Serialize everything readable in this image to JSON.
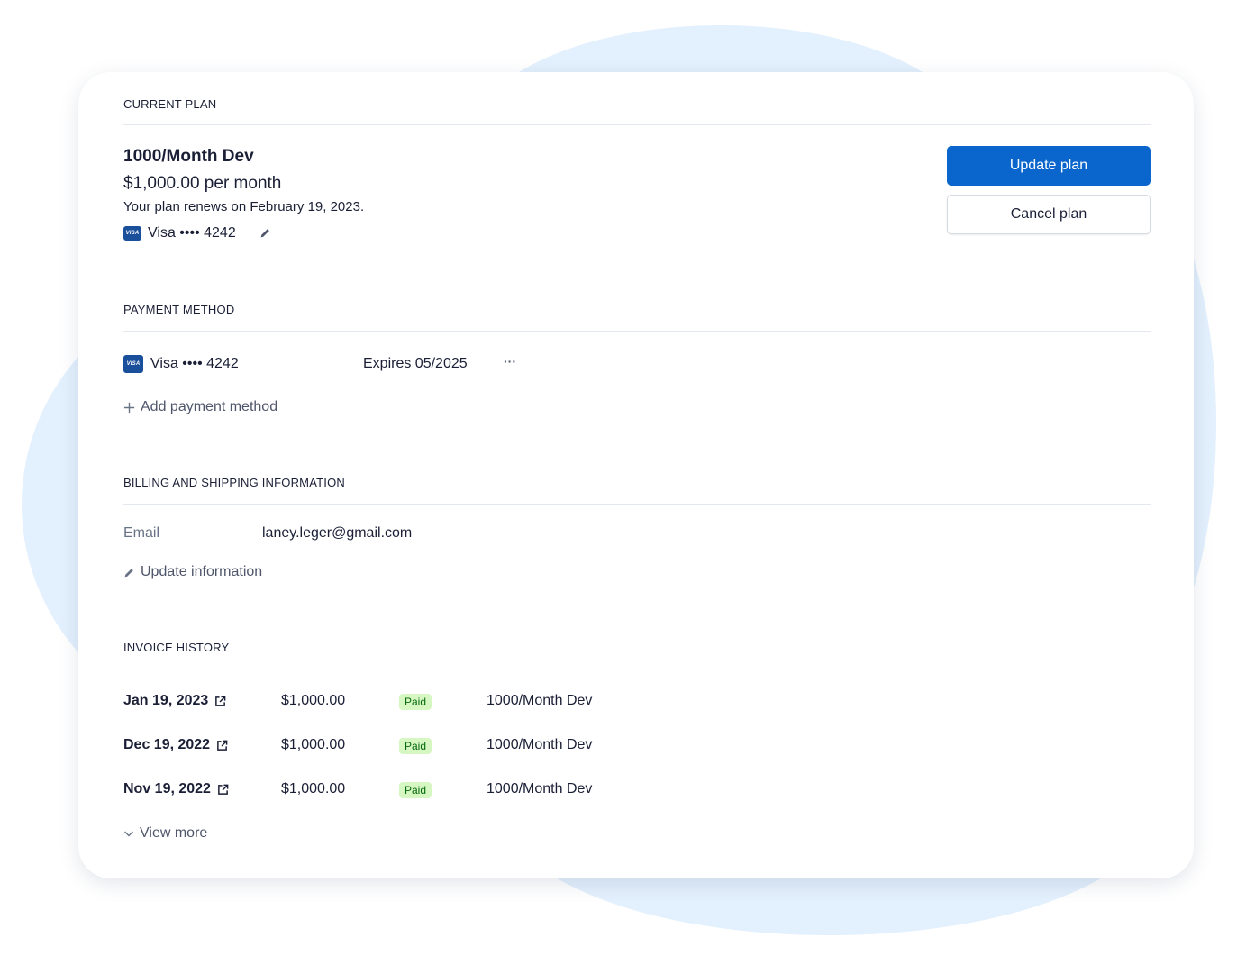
{
  "current_plan": {
    "section_title": "CURRENT PLAN",
    "plan_name": "1000/Month Dev",
    "price": "$1,000.00 per month",
    "renewal": "Your plan renews on February 19, 2023.",
    "card_brand": "VISA",
    "card_label": "Visa •••• 4242",
    "update_button": "Update plan",
    "cancel_button": "Cancel plan"
  },
  "payment_method": {
    "section_title": "PAYMENT METHOD",
    "card_brand": "VISA",
    "card_label": "Visa •••• 4242",
    "expires": "Expires 05/2025",
    "more_label": "···",
    "add_label": "Add payment method"
  },
  "billing": {
    "section_title": "BILLING AND SHIPPING INFORMATION",
    "email_label": "Email",
    "email_value": "laney.leger@gmail.com",
    "update_label": "Update information"
  },
  "invoices": {
    "section_title": "INVOICE HISTORY",
    "rows": [
      {
        "date": "Jan 19, 2023",
        "amount": "$1,000.00",
        "status": "Paid",
        "plan": "1000/Month Dev"
      },
      {
        "date": "Dec 19, 2022",
        "amount": "$1,000.00",
        "status": "Paid",
        "plan": "1000/Month Dev"
      },
      {
        "date": "Nov 19, 2022",
        "amount": "$1,000.00",
        "status": "Paid",
        "plan": "1000/Month Dev"
      }
    ],
    "view_more": "View more"
  },
  "colors": {
    "primary": "#0a66cc",
    "paid_bg": "#d7f7c2",
    "paid_text": "#05690d",
    "visa_blue": "#1a4f9c",
    "background_blob": "#e3f0fd"
  },
  "icons": {
    "card": "visa-card-icon",
    "edit": "pencil-icon",
    "add": "plus-icon",
    "external": "external-link-icon",
    "expand": "chevron-down-icon",
    "more": "ellipsis-icon"
  }
}
